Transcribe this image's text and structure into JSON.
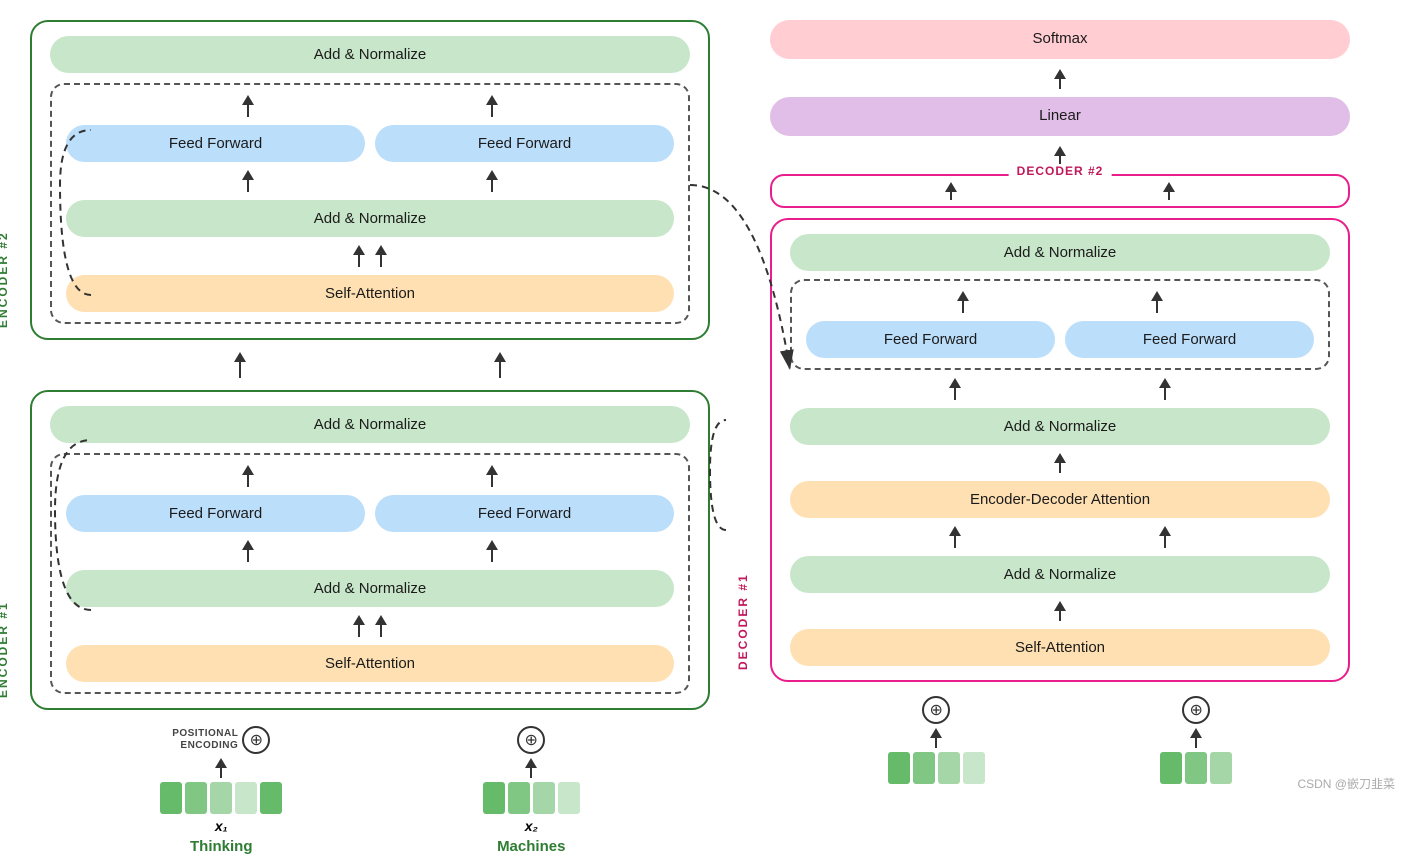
{
  "encoder": {
    "label1": "ENCODER #1",
    "label2": "ENCODER #2",
    "block1": {
      "add_norm_top": "Add & Normalize",
      "ff_left": "Feed Forward",
      "ff_right": "Feed Forward",
      "add_norm_bottom": "Add & Normalize",
      "self_attention": "Self-Attention"
    },
    "block2": {
      "add_norm_top": "Add & Normalize",
      "ff_left": "Feed Forward",
      "ff_right": "Feed Forward",
      "add_norm_bottom": "Add & Normalize",
      "self_attention": "Self-Attention"
    }
  },
  "decoder": {
    "label1": "DECODER #1",
    "label2": "DECODER #2",
    "softmax": "Softmax",
    "linear": "Linear",
    "block1": {
      "add_norm_top": "Add & Normalize",
      "ff_left": "Feed Forward",
      "ff_right": "Feed Forward",
      "add_norm_mid": "Add & Normalize",
      "enc_dec_attention": "Encoder-Decoder Attention",
      "add_norm_bottom": "Add & Normalize",
      "self_attention": "Self-Attention"
    }
  },
  "inputs": {
    "x1_label": "x₁",
    "x2_label": "x₂",
    "thinking": "Thinking",
    "machines": "Machines",
    "positional_encoding": "POSITIONAL\nENCODING"
  },
  "watermark": "CSDN @嵌刀韭菜",
  "colors": {
    "add_norm": "#c8e6c9",
    "feed_forward": "#bbdefb",
    "attention": "#ffe0b2",
    "softmax": "#ffcdd2",
    "linear": "#e1bee7",
    "encoder_border": "#2e7d32",
    "encoder_label": "#2e7d32",
    "decoder_border": "#e91e8c",
    "decoder_label": "#c2185b",
    "embedding_green": "#66bb6a"
  }
}
